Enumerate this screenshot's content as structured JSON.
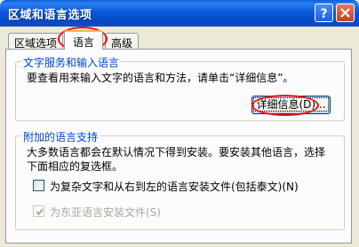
{
  "window": {
    "title": "区域和语言选项",
    "help_button": "?",
    "close_button": "×"
  },
  "tabs": [
    {
      "label": "区域选项",
      "active": false
    },
    {
      "label": "语言",
      "active": true
    },
    {
      "label": "高级",
      "active": false
    }
  ],
  "text_services": {
    "legend": "文字服务和输入语言",
    "description": "要查看用来输入文字的语言和方法，请单击“详细信息”。",
    "details_button": "详细信息(D)..."
  },
  "supplemental": {
    "legend": "附加的语言支持",
    "description_line1": "大多数语言都会在默认情况下得到安装。要安装其他语言，选择",
    "description_line2": "下面相应的复选框。",
    "complex_script_checkbox": {
      "label": "为复杂文字和从右到左的语言安装文件(包括泰文)(N)",
      "checked": false,
      "enabled": true
    },
    "east_asian_checkbox": {
      "label": "为东亚语言安装文件(S)",
      "checked": true,
      "enabled": false
    }
  },
  "colors": {
    "title_bar": "#0a58d8",
    "group_legend": "#0046d5",
    "annotation": "#ee1111"
  }
}
